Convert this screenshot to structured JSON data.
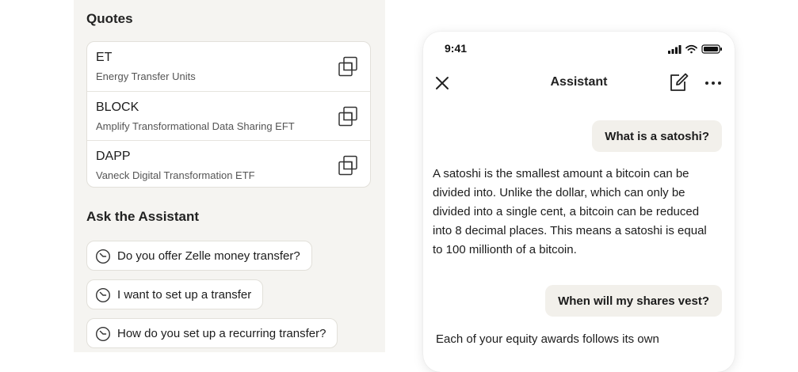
{
  "quotes": {
    "title": "Quotes",
    "items": [
      {
        "symbol": "ET",
        "name": "Energy Transfer Units"
      },
      {
        "symbol": "BLOCK",
        "name": "Amplify Transformational Data Sharing EFT"
      },
      {
        "symbol": "DAPP",
        "name": "Vaneck Digital Transformation ETF"
      }
    ],
    "copy_icon": "copy-icon"
  },
  "ask": {
    "title": "Ask the Assistant",
    "suggestions": [
      "Do you offer Zelle money transfer?",
      "I want to set up a transfer",
      "How do you set up a recurring transfer?"
    ],
    "suggestion_icon": "history-icon"
  },
  "phone": {
    "status": {
      "time": "9:41"
    },
    "header": {
      "title": "Assistant"
    },
    "messages": {
      "user_1": "What is a satoshi?",
      "assistant_1": "A satoshi is the smallest amount a bitcoin can be divided into. Unlike the dollar, which can only be divided into a single cent, a bitcoin can be reduced into 8 decimal places. This means a satoshi is equal to 100 millionth of a bitcoin.",
      "user_2": "When will my shares vest?",
      "assistant_2": "Each of your equity awards follows its own"
    }
  }
}
